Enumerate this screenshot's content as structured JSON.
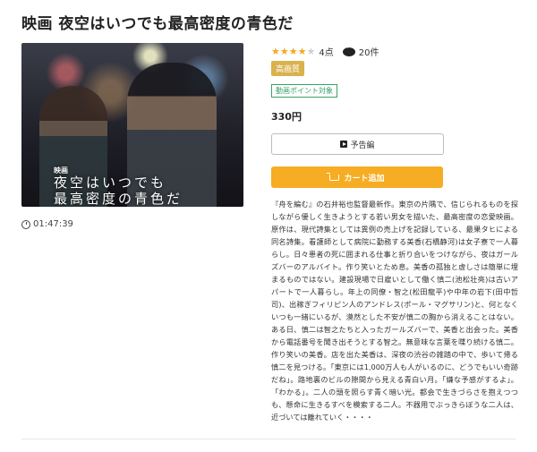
{
  "title": "映画 夜空はいつでも最高密度の青色だ",
  "poster": {
    "subtitle": "映画",
    "title": "夜空はいつでも\n最高密度の青色だ"
  },
  "duration": "01:47:39",
  "rating": {
    "stars_filled": 4,
    "stars_total": 5,
    "score": "4点",
    "comments": "20件"
  },
  "badges": {
    "hd": "高画質",
    "point": "動画ポイント対象"
  },
  "price": "330円",
  "buttons": {
    "trailer": "予告編",
    "cart": "カート追加"
  },
  "synopsis": "『舟を編む』の石井裕也監督最新作。東京の片隅で、信じられるものを探しながら優しく生きようとする若い男女を描いた、最高密度の恋愛映画。原作は、現代詩集としては異例の売上げを記録している、最果タヒによる同名詩集。看護師として病院に勤務する美香(石橋静河)は女子寮で一人暮らし。日々患者の死に囲まれる仕事と折り合いをつけながら、夜はガールズバーのアルバイト。作り笑いとため息。美香の孤独と虚しさは簡単に埋まるものではない。建設現場で日雇いとして働く慎二(池松壮亮)は古いアパートで一人暮らし。年上の同僚・智之(松田龍平)や中年の岩下(田中哲司)、出稼ぎフィリピン人のアンドレス(ポール・マグサリン)と、何となくいつも一緒にいるが、漠然とした不安が慎二の胸から消えることはない。ある日、慎二は智之たちと入ったガールズバーで、美香と出会った。美香から電話番号を聞き出そうとする智之。無意味な言葉を喋り続ける慎二。作り笑いの美香。店を出た美香は、深夜の渋谷の雑踏の中で、歩いて帰る慎二を見つける。「東京には1,000万人も人がいるのに、どうでもいい奇跡だね」。路地裏のビルの隙間から見える青白い月。「嫌な予感がするよ」。「わかる」。二人の頭を照らす青く暗い光。都会で生きづらさを抱えつつも、懸命に生きるすべを模索する二人。不器用でぶっきらぼうな二人は、近づいては離れていく・・・・"
}
